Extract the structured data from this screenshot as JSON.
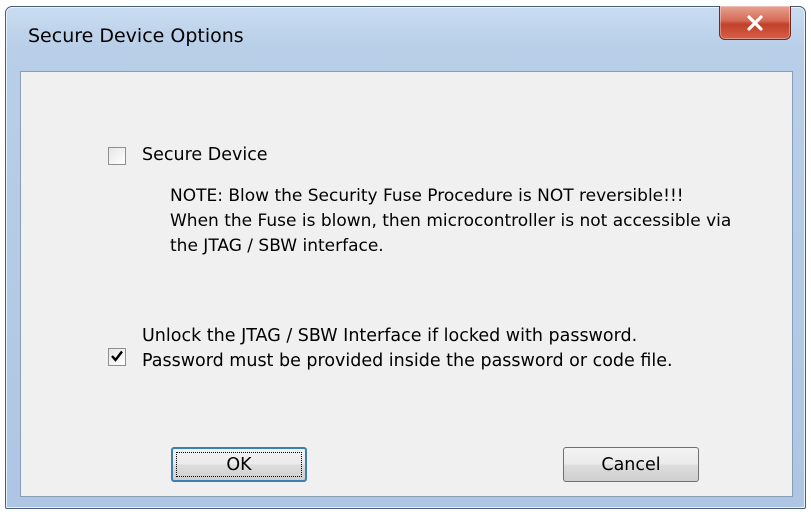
{
  "window": {
    "title": "Secure Device Options"
  },
  "close_button": {
    "icon": "close-icon",
    "glyph": "X"
  },
  "secure_device": {
    "label": "Secure Device",
    "checked": false,
    "note_lines": [
      "NOTE: Blow the Security Fuse Procedure is NOT reversible!!!",
      "When the Fuse is blown, then microcontroller is not accessible via",
      "the JTAG / SBW interface."
    ]
  },
  "unlock": {
    "checked": true,
    "label_lines": [
      "Unlock the JTAG / SBW Interface if locked with password.",
      "Password must be provided inside the password or code file."
    ]
  },
  "buttons": {
    "ok": "OK",
    "cancel": "Cancel"
  },
  "colors": {
    "title_bar": "#b9cfe8",
    "client_bg": "#f0f0f0",
    "close_red": "#c2412a",
    "default_button_border": "#3c7fb1"
  }
}
